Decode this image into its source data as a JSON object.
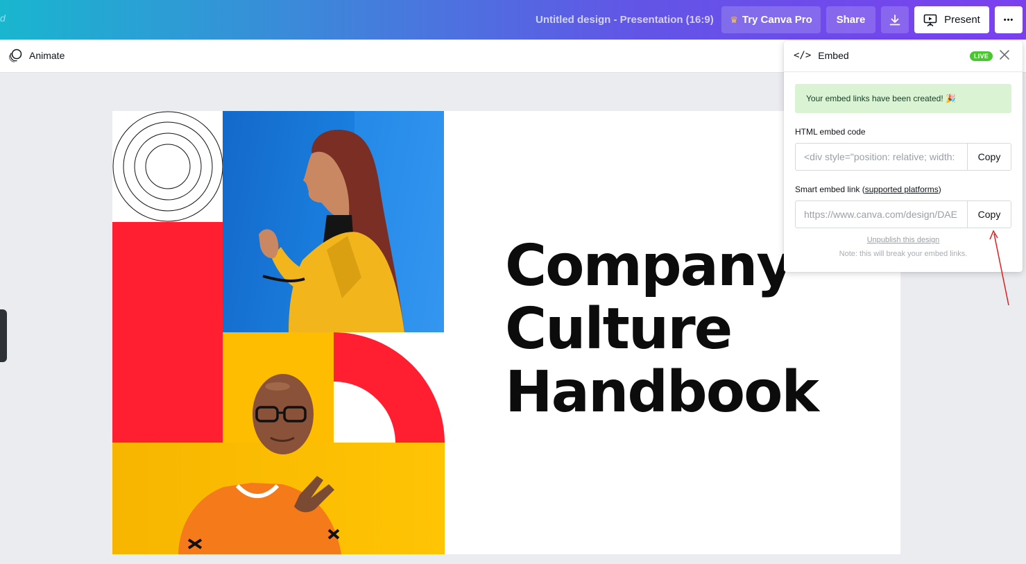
{
  "topbar": {
    "edge_glyph": "d",
    "doc_title": "Untitled design - Presentation (16:9)",
    "try_pro_label": "Try Canva Pro",
    "crown_icon": "crown-icon",
    "share_label": "Share",
    "download_icon": "download-icon",
    "present_label": "Present",
    "present_icon": "present-screen-icon",
    "more_icon": "more-dots-icon",
    "more_glyph": "•••"
  },
  "toolbar": {
    "animate_label": "Animate",
    "animate_icon": "animate-icon"
  },
  "slide": {
    "title_lines": [
      "Company",
      "Culture",
      "Handbook"
    ],
    "colors": {
      "red": "#ff1f31",
      "yellow": "#ffbd00",
      "blue": "#1a80e0"
    }
  },
  "embed_panel": {
    "title": "Embed",
    "code_glyph": "</>",
    "live_badge": "LIVE",
    "success_message": "Your embed links have been created! 🎉",
    "html_label": "HTML embed code",
    "html_value": "<div style=\"position: relative; width:",
    "copy_label": "Copy",
    "smart_label_prefix": "Smart embed link (",
    "smart_label_link": "supported platforms",
    "smart_label_suffix": ")",
    "smart_value": "https://www.canva.com/design/DAE",
    "unpublish_label": "Unpublish this design",
    "note": "Note: this will break your embed links."
  },
  "annotation": {
    "arrow_color": "#e41c1c"
  }
}
